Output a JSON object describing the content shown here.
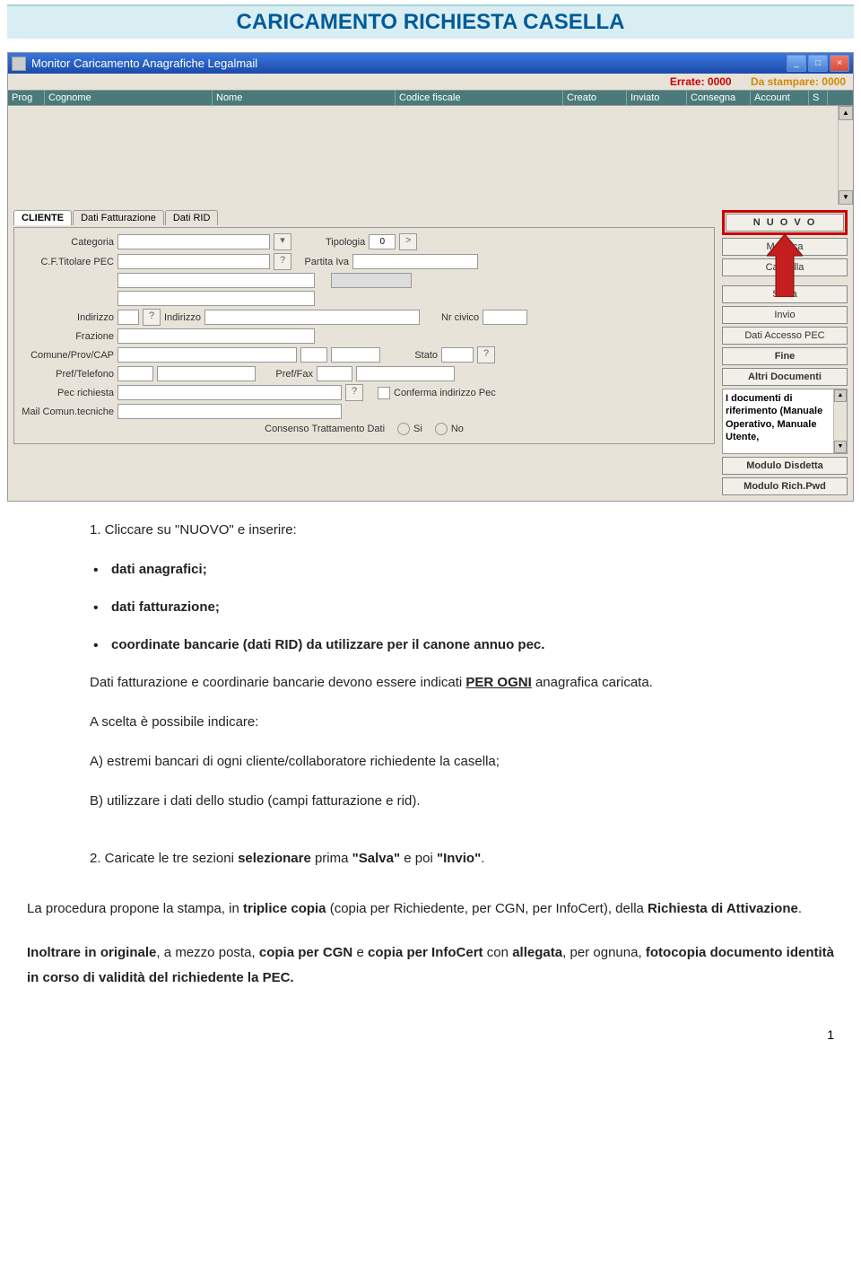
{
  "title": "CARICAMENTO RICHIESTA CASELLA",
  "window": {
    "title": "Monitor Caricamento Anagrafiche Legalmail",
    "status": {
      "errate_label": "Errate: 0000",
      "da_stampare_label": "Da stampare: 0000"
    },
    "columns": {
      "prog": "Prog",
      "cognome": "Cognome",
      "nome": "Nome",
      "cf": "Codice fiscale",
      "creato": "Creato",
      "inviato": "Inviato",
      "consegna": "Consegna",
      "account": "Account",
      "s": "S"
    },
    "tabs": {
      "cliente": "CLIENTE",
      "fatturazione": "Dati Fatturazione",
      "rid": "Dati RID"
    },
    "fields": {
      "categoria": "Categoria",
      "tipologia": "Tipologia",
      "tipologia_val": "0",
      "cf_titolare": "C.F.Titolare PEC",
      "piva": "Partita Iva",
      "indirizzo_short": "Indirizzo",
      "indirizzo": "Indirizzo",
      "nr_civico": "Nr civico",
      "frazione": "Frazione",
      "comune": "Comune/Prov/CAP",
      "stato": "Stato",
      "pref_tel": "Pref/Telefono",
      "pref_fax": "Pref/Fax",
      "pec_richiesta": "Pec richiesta",
      "conferma_pec": "Conferma indirizzo Pec",
      "mail_tec": "Mail Comun.tecniche",
      "consenso": "Consenso Trattamento Dati",
      "si": "Si",
      "no": "No"
    },
    "buttons": {
      "nuovo": "N U O V O",
      "modifica": "Modifica",
      "cancella": "Cancella",
      "salva": "Salva",
      "invio": "Invio",
      "dati_accesso": "Dati Accesso PEC",
      "fine": "Fine",
      "altri_doc": "Altri Documenti",
      "documenti_text": "I documenti di riferimento (Manuale Operativo, Manuale Utente,",
      "modulo_disdetta": "Modulo Disdetta",
      "modulo_rich": "Modulo Rich.Pwd"
    }
  },
  "doc": {
    "step1": "1.   Cliccare su \"NUOVO\" e  inserire:",
    "bullet1": "dati anagrafici;",
    "bullet2": "dati fatturazione;",
    "bullet3": "coordinate bancarie (dati RID) da utilizzare per il canone annuo pec.",
    "p_fatt_a": "Dati fatturazione e coordinarie bancarie devono essere indicati ",
    "p_fatt_b": "PER OGNI",
    "p_fatt_c": " anagrafica caricata.",
    "p_scelta": "A scelta è possibile indicare:",
    "p_a": "A) estremi bancari di ogni cliente/collaboratore richiedente la casella;",
    "p_b": "B) utilizzare i dati dello studio (campi fatturazione e rid).",
    "step2a": "2.   Caricate le tre sezioni ",
    "step2b": "selezionare",
    "step2c": " prima ",
    "step2d": "\"Salva\"",
    "step2e": " e poi ",
    "step2f": "\"Invio\"",
    "step2g": ".",
    "p_stampa_a": "La procedura propone la stampa, in ",
    "p_stampa_b": "triplice copia",
    "p_stampa_c": " (copia per Richiedente, per CGN, per InfoCert), della ",
    "p_stampa_d": "Richiesta di Attivazione",
    "p_stampa_e": ".",
    "p_inoltr_a": "Inoltrare in originale",
    "p_inoltr_b": ", a mezzo posta, ",
    "p_inoltr_c": "copia per CGN",
    "p_inoltr_d": " e ",
    "p_inoltr_e": "copia per InfoCert",
    "p_inoltr_f": " con ",
    "p_inoltr_g": "allegata",
    "p_inoltr_h": ", per ognuna,  ",
    "p_inoltr_i": "fotocopia documento identità in corso di validità del richiedente la PEC.",
    "page_num": "1"
  }
}
